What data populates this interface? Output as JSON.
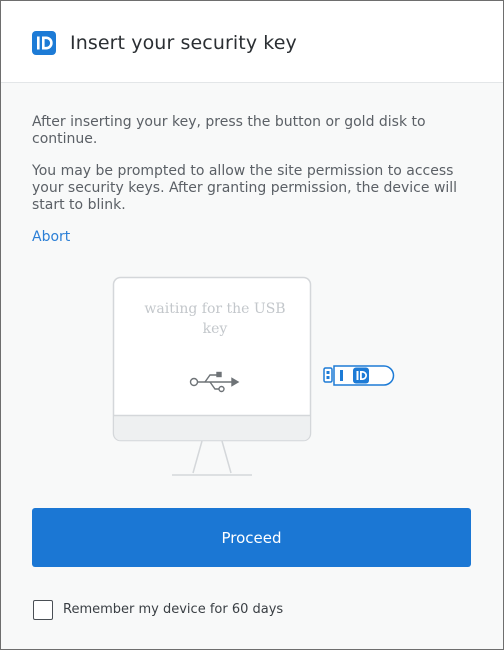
{
  "header": {
    "logo_text": "ID",
    "title": "Insert your security key"
  },
  "main": {
    "instruction_1": "After inserting your key, press the button or gold disk to continue.",
    "instruction_2": "You may be prompted to allow the site permission to access your security keys. After granting permission, the device will start to blink.",
    "abort_label": "Abort"
  },
  "illustration": {
    "status_text": "waiting for the USB key",
    "usb_key_logo_text": "ID"
  },
  "actions": {
    "proceed_label": "Proceed",
    "remember_label": "Remember my device for 60 days",
    "remember_checked": false
  },
  "colors": {
    "accent": "#1b77d4",
    "link": "#2b7fd6",
    "background": "#f8f9f9",
    "header_bg": "#ffffff"
  }
}
